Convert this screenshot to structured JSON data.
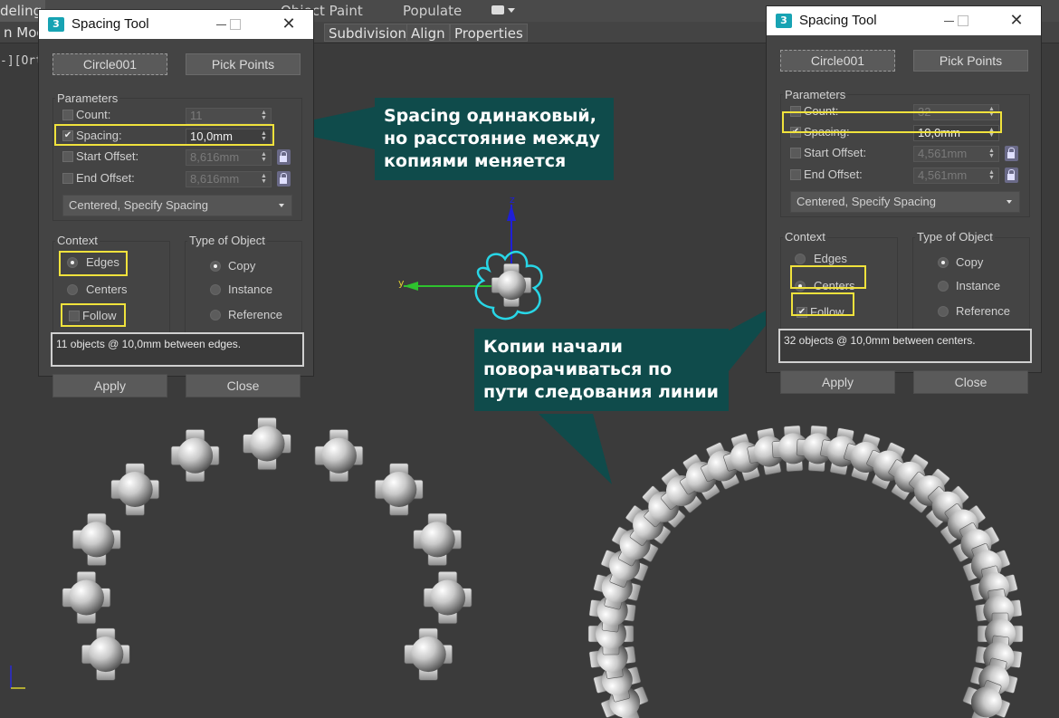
{
  "app": {
    "tabs": [
      "deling",
      "Populate",
      "Object Paint"
    ],
    "toolbar": [
      "n Mod",
      "Subdivision",
      "Align",
      "Properties"
    ],
    "viewport_label": "-][Ort",
    "axis_label_y": "y",
    "axis_label_z": "z"
  },
  "dialog_left": {
    "title": "Spacing Tool",
    "close_glyph": "✕",
    "pick_object": "Circle001",
    "pick_points": "Pick Points",
    "parameters": "Parameters",
    "count_label": "Count:",
    "count_value": "11",
    "spacing_label": "Spacing:",
    "spacing_value": "10,0mm",
    "start_offset_label": "Start Offset:",
    "start_offset_value": "8,616mm",
    "end_offset_label": "End Offset:",
    "end_offset_value": "8,616mm",
    "mode": "Centered, Specify Spacing",
    "context": "Context",
    "edges": "Edges",
    "centers": "Centers",
    "follow": "Follow",
    "type_of_object": "Type of Object",
    "copy": "Copy",
    "instance": "Instance",
    "reference": "Reference",
    "status": "11 objects @ 10,0mm  between edges.",
    "apply": "Apply",
    "close": "Close",
    "spacing_checked": true,
    "context_selected": "Edges",
    "follow_checked": false,
    "type_selected": "Copy"
  },
  "dialog_right": {
    "title": "Spacing Tool",
    "close_glyph": "✕",
    "pick_object": "Circle001",
    "pick_points": "Pick Points",
    "parameters": "Parameters",
    "count_label": "Count:",
    "count_value": "32",
    "spacing_label": "Spacing:",
    "spacing_value": "10,0mm",
    "start_offset_label": "Start Offset:",
    "start_offset_value": "4,561mm",
    "end_offset_label": "End Offset:",
    "end_offset_value": "4,561mm",
    "mode": "Centered, Specify Spacing",
    "context": "Context",
    "edges": "Edges",
    "centers": "Centers",
    "follow": "Follow",
    "type_of_object": "Type of Object",
    "copy": "Copy",
    "instance": "Instance",
    "reference": "Reference",
    "status": "32 objects @ 10,0mm  between centers.",
    "apply": "Apply",
    "close": "Close",
    "spacing_checked": true,
    "context_selected": "Centers",
    "follow_checked": true,
    "type_selected": "Copy"
  },
  "callout_top": [
    "Spacing одинаковый,",
    "но расстояние между",
    "копиями меняется"
  ],
  "callout_bottom": [
    "Копии начали",
    "поворачиваться по",
    "пути следования линии"
  ],
  "colors": {
    "callout_bg": "#0f4b4b",
    "highlight": "#f0e23c",
    "viewport_bg": "#3b3b3b",
    "gizmo_z": "#1f1fd6",
    "gizmo_y": "#2ec22e",
    "gizmo_x": "#e0d030",
    "selection": "#28d6e6"
  }
}
